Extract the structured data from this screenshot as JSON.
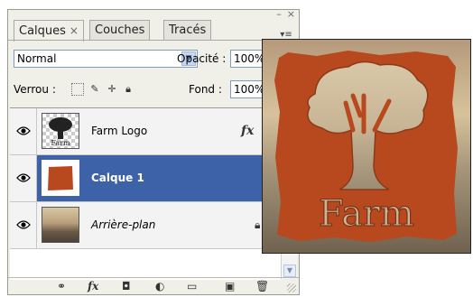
{
  "tabs": [
    {
      "label": "Calques",
      "close": "×"
    },
    {
      "label": "Couches"
    },
    {
      "label": "Tracés"
    }
  ],
  "panel_controls": {
    "minimize": "–",
    "close": "×",
    "menu": "▾≡"
  },
  "blend_mode": {
    "value": "Normal",
    "arrow_icon": "chevron-down-icon"
  },
  "opacity": {
    "label": "Opacité :",
    "value": "100%"
  },
  "lock": {
    "label": "Verrou :",
    "icons": [
      "lock-transparency-icon",
      "lock-paint-icon",
      "lock-position-icon",
      "lock-all-icon"
    ]
  },
  "fill": {
    "label": "Fond :",
    "value": "100%"
  },
  "layers": [
    {
      "name": "Farm Logo",
      "visible": true,
      "selected": false,
      "effects": "fx",
      "thumb_text": "Farm"
    },
    {
      "name": "Calque 1",
      "visible": true,
      "selected": true
    },
    {
      "name": "Arrière-plan",
      "visible": true,
      "selected": false,
      "locked": true,
      "italic": true
    }
  ],
  "bottom_toolbar": {
    "icons": [
      "link-layers-icon",
      "fx-icon",
      "add-mask-icon",
      "adjustment-layer-icon",
      "new-group-icon",
      "new-layer-icon",
      "delete-layer-icon"
    ],
    "fx_label": "fx"
  },
  "preview": {
    "logo_text": "Farm"
  },
  "colors": {
    "selected_row": "#3d62a7",
    "swatch_orange": "#b8491f"
  }
}
